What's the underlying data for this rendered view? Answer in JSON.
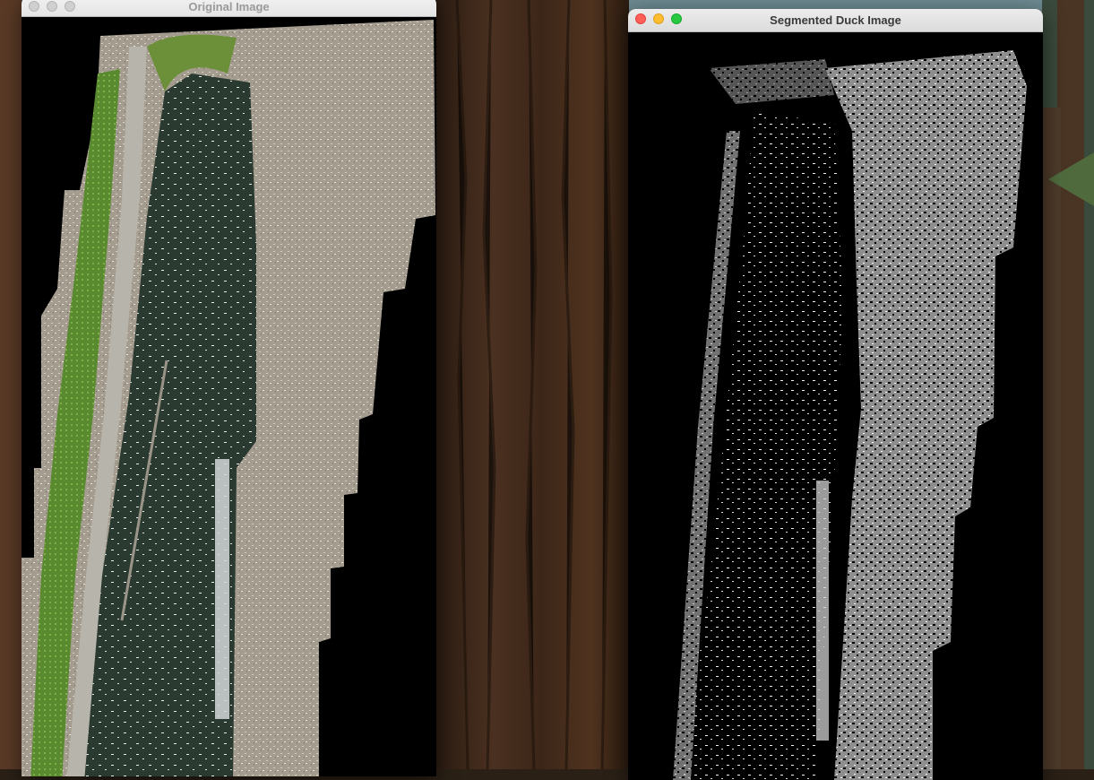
{
  "desktop": {
    "wallpaper": "redwood-forest"
  },
  "windows": {
    "original": {
      "title": "Original Image",
      "state": "inactive",
      "image": "aerial-duck-pond-photo"
    },
    "segmented": {
      "title": "Segmented Duck Image",
      "state": "active",
      "image": "segmented-duck-mask"
    }
  },
  "colors": {
    "close": "#ff5f57",
    "minimize": "#febc2e",
    "maximize": "#28c840",
    "inactive_light": "#d0d0d0"
  }
}
